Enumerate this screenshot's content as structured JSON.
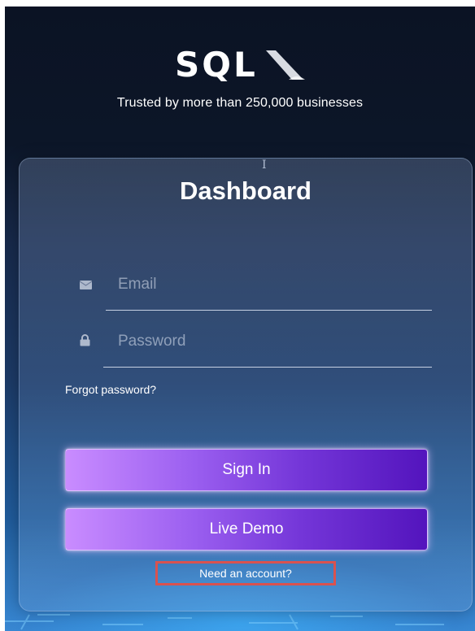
{
  "brand": {
    "logo_text": "SQL",
    "tagline": "Trusted by more than 250,000 businesses"
  },
  "card": {
    "title": "Dashboard",
    "email": {
      "placeholder": "Email",
      "icon": "envelope-icon"
    },
    "password": {
      "placeholder": "Password",
      "icon": "lock-icon"
    },
    "forgot_label": "Forgot password?",
    "sign_in_label": "Sign In",
    "live_demo_label": "Live Demo",
    "need_account_label": "Need an account?"
  },
  "colors": {
    "button_gradient_start": "#c98cff",
    "button_gradient_end": "#5314bd",
    "highlight_box": "#d9524f",
    "background_top": "#0b1324"
  }
}
